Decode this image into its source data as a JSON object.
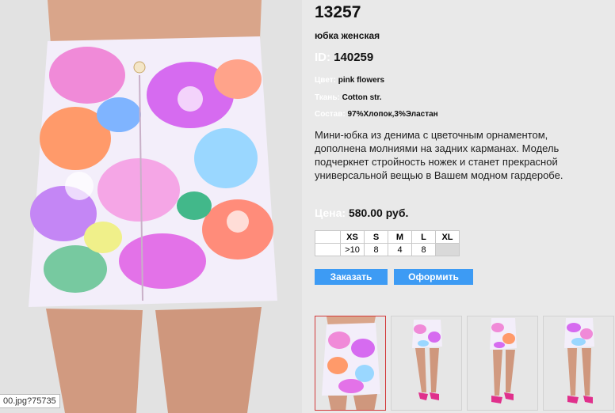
{
  "product": {
    "sku": "13257",
    "type": "юбка женская",
    "id_label": "ID:",
    "id_value": "140259",
    "color_label": "Цвет:",
    "color_value": "pink flowers",
    "fabric_label": "Ткань:",
    "fabric_value": "Cotton str.",
    "composition_label": "Состав:",
    "composition_value": "97%Хлопок,3%Эластан",
    "description": "Мини-юбка из денима с цветочным орнаментом, дополнена молниями на задних карманах. Модель подчеркнет стройность ножек и станет прекрасной универсальной вещью в Вашем модном гардеробе.",
    "price_label": "Цена:",
    "price_value": "580.00 руб."
  },
  "sizes": {
    "headers": [
      "XS",
      "S",
      "M",
      "L",
      "XL"
    ],
    "stock": [
      ">10",
      "8",
      "4",
      "8",
      ""
    ]
  },
  "buttons": {
    "order": "Заказать",
    "checkout": "Оформить"
  },
  "status_url": "00.jpg?75735",
  "colors": {
    "button": "#3d9bf4",
    "selected_thumb_border": "#d23b3b",
    "label_white": "#ffffff"
  },
  "thumbnails": [
    "thumb-closeup-skirt",
    "thumb-front-full",
    "thumb-side-full",
    "thumb-back-full"
  ]
}
